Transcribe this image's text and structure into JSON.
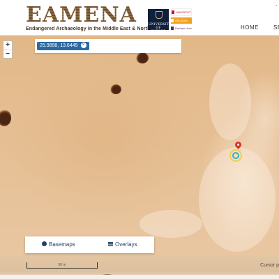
{
  "header": {
    "logo_title": "EAMENA",
    "logo_subtitle": "Endangered Archaeology in the Middle East & North Africa",
    "partner_oxford": "UNIVERSITY OF OXFORD",
    "partner_leicester": "UNIVERSITY OF LEICESTER",
    "partner_palladium": "ARCADIA",
    "partner_durham": "Durham University",
    "nav": {
      "home": "HOME",
      "second": "SE",
      "menu": "·"
    }
  },
  "map": {
    "zoom_in": "+",
    "zoom_out": "−",
    "coordinate": "25.9898, 13.6445",
    "clear_coordinate": "×",
    "layers": {
      "basemaps": "Basemaps",
      "overlays": "Overlays"
    },
    "scale_label": "50 m",
    "cursor_label": "Cursor p"
  },
  "colors": {
    "accent_blue": "#2b6aa3",
    "marker_red": "#d9342b",
    "site_teal": "#34b3b0",
    "site_yellow": "#e8d25a"
  }
}
